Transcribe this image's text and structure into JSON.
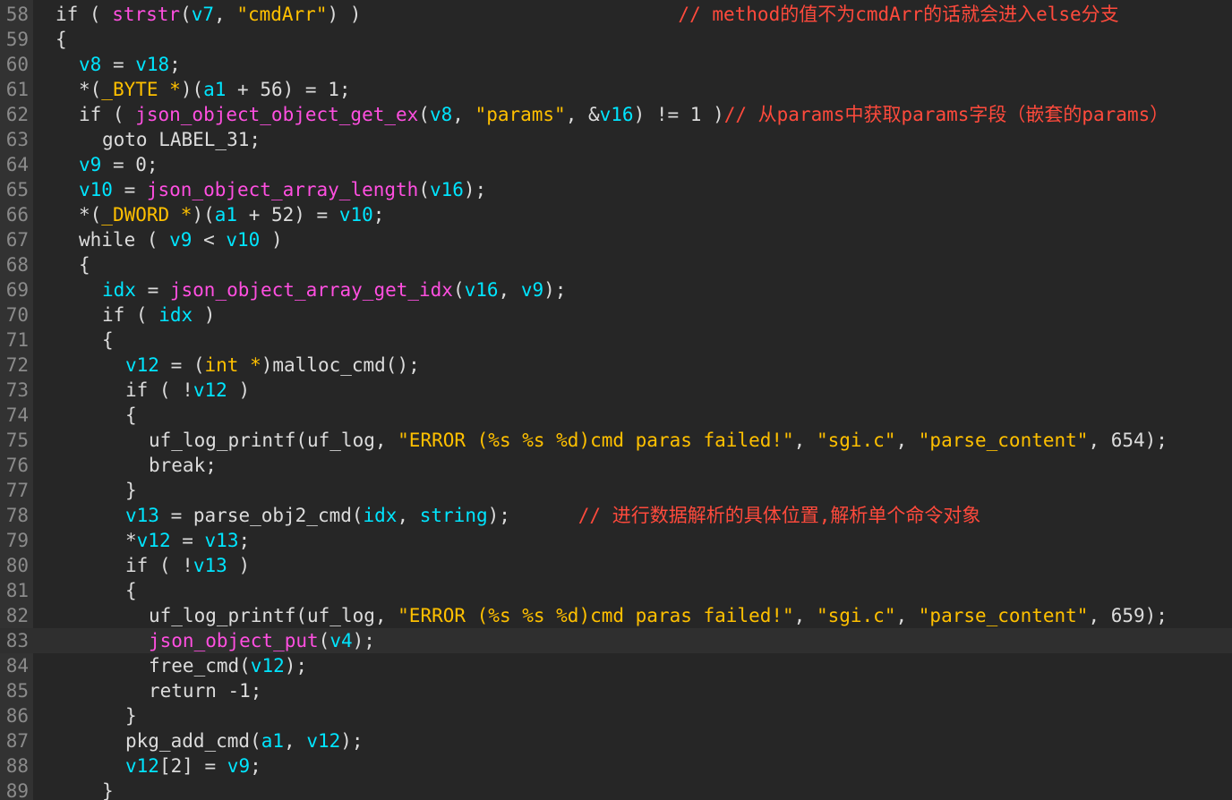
{
  "theme": {
    "background": "#262626",
    "gutter": "#323232",
    "line_number": "#8b8b8b",
    "plain": "#dcdcdc",
    "variable": "#00e5ff",
    "function": "#ff4fe0",
    "string": "#ffc000",
    "comment": "#ff4a3c",
    "current_line": "#2f2f2f"
  },
  "lines": [
    {
      "n": "58",
      "indent": 0,
      "tokens": [
        [
          "plain",
          "if ( "
        ],
        [
          "func",
          "strstr"
        ],
        [
          "plain",
          "("
        ],
        [
          "var",
          "v7"
        ],
        [
          "plain",
          ", "
        ],
        [
          "str",
          "\"cmdArr\""
        ],
        [
          "plain",
          ") )                            "
        ],
        [
          "comm",
          "// method的值不为cmdArr的话就会进入else分支"
        ]
      ]
    },
    {
      "n": "59",
      "indent": 0,
      "tokens": [
        [
          "plain",
          "{"
        ]
      ]
    },
    {
      "n": "60",
      "indent": 1,
      "tokens": [
        [
          "var",
          "v8"
        ],
        [
          "plain",
          " = "
        ],
        [
          "var",
          "v18"
        ],
        [
          "plain",
          ";"
        ]
      ]
    },
    {
      "n": "61",
      "indent": 1,
      "tokens": [
        [
          "plain",
          "*("
        ],
        [
          "type",
          "_BYTE *"
        ],
        [
          "plain",
          ")("
        ],
        [
          "var",
          "a1"
        ],
        [
          "plain",
          " + 56) = 1;"
        ]
      ]
    },
    {
      "n": "62",
      "indent": 1,
      "tokens": [
        [
          "plain",
          "if ( "
        ],
        [
          "func",
          "json_object_object_get_ex"
        ],
        [
          "plain",
          "("
        ],
        [
          "var",
          "v8"
        ],
        [
          "plain",
          ", "
        ],
        [
          "str",
          "\"params\""
        ],
        [
          "plain",
          ", &"
        ],
        [
          "var",
          "v16"
        ],
        [
          "plain",
          ") != 1 )"
        ],
        [
          "comm",
          "// 从params中获取params字段（嵌套的params）"
        ]
      ]
    },
    {
      "n": "63",
      "indent": 2,
      "tokens": [
        [
          "plain",
          "goto LABEL_31;"
        ]
      ]
    },
    {
      "n": "64",
      "indent": 1,
      "tokens": [
        [
          "var",
          "v9"
        ],
        [
          "plain",
          " = 0;"
        ]
      ]
    },
    {
      "n": "65",
      "indent": 1,
      "tokens": [
        [
          "var",
          "v10"
        ],
        [
          "plain",
          " = "
        ],
        [
          "func",
          "json_object_array_length"
        ],
        [
          "plain",
          "("
        ],
        [
          "var",
          "v16"
        ],
        [
          "plain",
          ");"
        ]
      ]
    },
    {
      "n": "66",
      "indent": 1,
      "tokens": [
        [
          "plain",
          "*("
        ],
        [
          "type",
          "_DWORD *"
        ],
        [
          "plain",
          ")("
        ],
        [
          "var",
          "a1"
        ],
        [
          "plain",
          " + 52) = "
        ],
        [
          "var",
          "v10"
        ],
        [
          "plain",
          ";"
        ]
      ]
    },
    {
      "n": "67",
      "indent": 1,
      "tokens": [
        [
          "plain",
          "while ( "
        ],
        [
          "var",
          "v9"
        ],
        [
          "plain",
          " < "
        ],
        [
          "var",
          "v10"
        ],
        [
          "plain",
          " )"
        ]
      ]
    },
    {
      "n": "68",
      "indent": 1,
      "tokens": [
        [
          "plain",
          "{"
        ]
      ]
    },
    {
      "n": "69",
      "indent": 2,
      "tokens": [
        [
          "var",
          "idx"
        ],
        [
          "plain",
          " = "
        ],
        [
          "func",
          "json_object_array_get_idx"
        ],
        [
          "plain",
          "("
        ],
        [
          "var",
          "v16"
        ],
        [
          "plain",
          ", "
        ],
        [
          "var",
          "v9"
        ],
        [
          "plain",
          ");"
        ]
      ]
    },
    {
      "n": "70",
      "indent": 2,
      "tokens": [
        [
          "plain",
          "if ( "
        ],
        [
          "var",
          "idx"
        ],
        [
          "plain",
          " )"
        ]
      ]
    },
    {
      "n": "71",
      "indent": 2,
      "tokens": [
        [
          "plain",
          "{"
        ]
      ]
    },
    {
      "n": "72",
      "indent": 3,
      "tokens": [
        [
          "var",
          "v12"
        ],
        [
          "plain",
          " = ("
        ],
        [
          "type",
          "int *"
        ],
        [
          "plain",
          ")malloc_cmd();"
        ]
      ]
    },
    {
      "n": "73",
      "indent": 3,
      "tokens": [
        [
          "plain",
          "if ( !"
        ],
        [
          "var",
          "v12"
        ],
        [
          "plain",
          " )"
        ]
      ]
    },
    {
      "n": "74",
      "indent": 3,
      "tokens": [
        [
          "plain",
          "{"
        ]
      ]
    },
    {
      "n": "75",
      "indent": 4,
      "tokens": [
        [
          "plain",
          "uf_log_printf(uf_log, "
        ],
        [
          "str",
          "\"ERROR (%s %s %d)cmd paras failed!\""
        ],
        [
          "plain",
          ", "
        ],
        [
          "str",
          "\"sgi.c\""
        ],
        [
          "plain",
          ", "
        ],
        [
          "str",
          "\"parse_content\""
        ],
        [
          "plain",
          ", 654);"
        ]
      ]
    },
    {
      "n": "76",
      "indent": 4,
      "tokens": [
        [
          "plain",
          "break;"
        ]
      ]
    },
    {
      "n": "77",
      "indent": 3,
      "tokens": [
        [
          "plain",
          "}"
        ]
      ]
    },
    {
      "n": "78",
      "indent": 3,
      "tokens": [
        [
          "var",
          "v13"
        ],
        [
          "plain",
          " = parse_obj2_cmd("
        ],
        [
          "var",
          "idx"
        ],
        [
          "plain",
          ", "
        ],
        [
          "var",
          "string"
        ],
        [
          "plain",
          ");      "
        ],
        [
          "comm",
          "// 进行数据解析的具体位置,解析单个命令对象"
        ]
      ]
    },
    {
      "n": "79",
      "indent": 3,
      "tokens": [
        [
          "plain",
          "*"
        ],
        [
          "var",
          "v12"
        ],
        [
          "plain",
          " = "
        ],
        [
          "var",
          "v13"
        ],
        [
          "plain",
          ";"
        ]
      ]
    },
    {
      "n": "80",
      "indent": 3,
      "tokens": [
        [
          "plain",
          "if ( !"
        ],
        [
          "var",
          "v13"
        ],
        [
          "plain",
          " )"
        ]
      ]
    },
    {
      "n": "81",
      "indent": 3,
      "tokens": [
        [
          "plain",
          "{"
        ]
      ]
    },
    {
      "n": "82",
      "indent": 4,
      "tokens": [
        [
          "plain",
          "uf_log_printf(uf_log, "
        ],
        [
          "str",
          "\"ERROR (%s %s %d)cmd paras failed!\""
        ],
        [
          "plain",
          ", "
        ],
        [
          "str",
          "\"sgi.c\""
        ],
        [
          "plain",
          ", "
        ],
        [
          "str",
          "\"parse_content\""
        ],
        [
          "plain",
          ", 659);"
        ]
      ]
    },
    {
      "n": "83",
      "indent": 4,
      "current": true,
      "tokens": [
        [
          "func",
          "json_object_put"
        ],
        [
          "plain",
          "("
        ],
        [
          "var",
          "v4"
        ],
        [
          "plain",
          ");"
        ]
      ]
    },
    {
      "n": "84",
      "indent": 4,
      "tokens": [
        [
          "plain",
          "free_cmd("
        ],
        [
          "var",
          "v12"
        ],
        [
          "plain",
          ");"
        ]
      ]
    },
    {
      "n": "85",
      "indent": 4,
      "tokens": [
        [
          "plain",
          "return -1;"
        ]
      ]
    },
    {
      "n": "86",
      "indent": 3,
      "tokens": [
        [
          "plain",
          "}"
        ]
      ]
    },
    {
      "n": "87",
      "indent": 3,
      "tokens": [
        [
          "plain",
          "pkg_add_cmd("
        ],
        [
          "var",
          "a1"
        ],
        [
          "plain",
          ", "
        ],
        [
          "var",
          "v12"
        ],
        [
          "plain",
          ");"
        ]
      ]
    },
    {
      "n": "88",
      "indent": 3,
      "tokens": [
        [
          "var",
          "v12"
        ],
        [
          "plain",
          "[2] = "
        ],
        [
          "var",
          "v9"
        ],
        [
          "plain",
          ";"
        ]
      ]
    },
    {
      "n": "89",
      "indent": 2,
      "tokens": [
        [
          "plain",
          "}"
        ]
      ]
    }
  ]
}
